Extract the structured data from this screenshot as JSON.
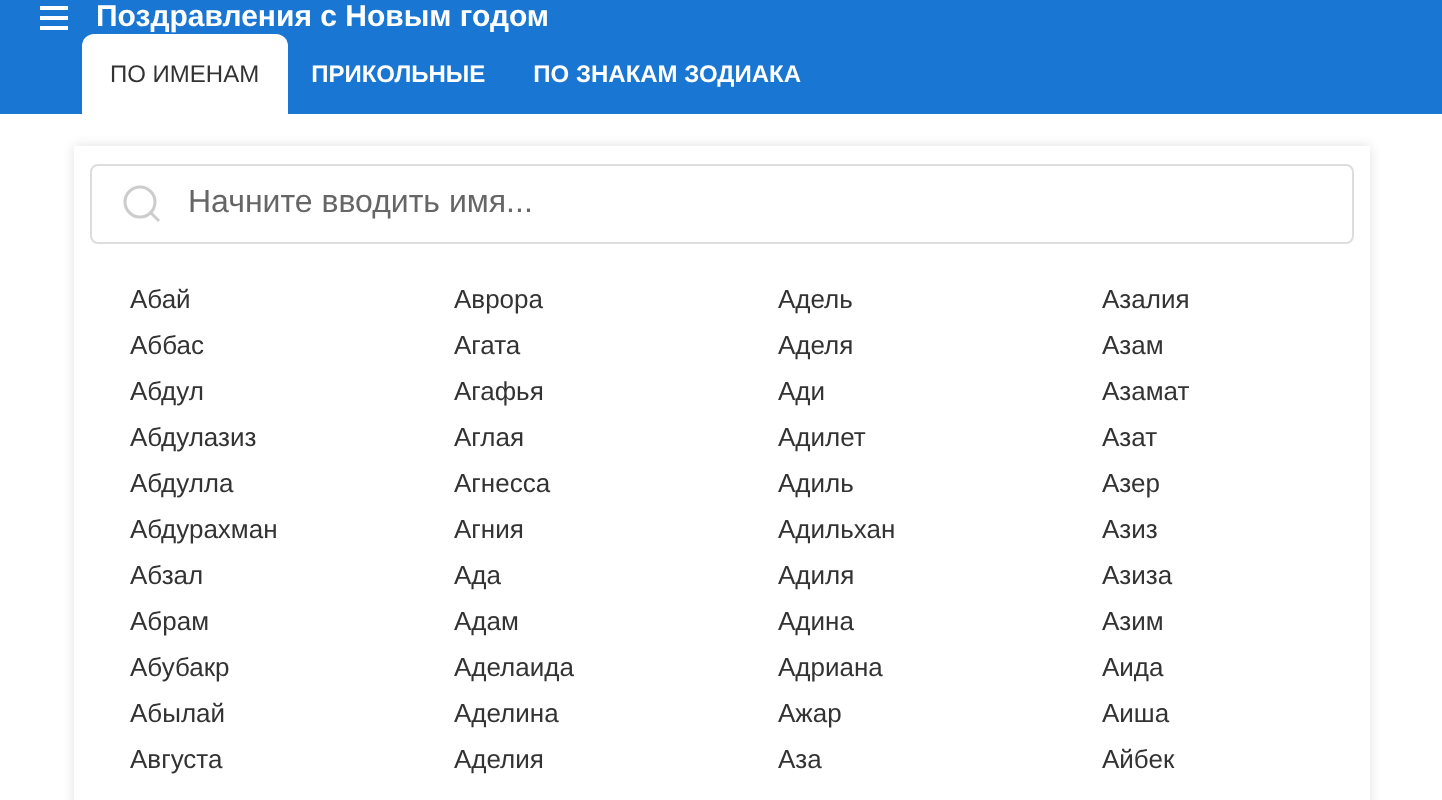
{
  "header": {
    "title": "Поздравления с Новым годом"
  },
  "tabs": [
    {
      "label": "ПО ИМЕНАМ",
      "selected": true
    },
    {
      "label": "ПРИКОЛЬНЫЕ",
      "selected": false
    },
    {
      "label": "ПО ЗНАКАМ ЗОДИАКА",
      "selected": false
    }
  ],
  "search": {
    "placeholder": "Начните вводить имя..."
  },
  "name_columns": [
    [
      "Абай",
      "Аббас",
      "Абдул",
      "Абдулазиз",
      "Абдулла",
      "Абдурахман",
      "Абзал",
      "Абрам",
      "Абубакр",
      "Абылай",
      "Августа"
    ],
    [
      "Аврора",
      "Агата",
      "Агафья",
      "Аглая",
      "Агнесса",
      "Агния",
      "Ада",
      "Адам",
      "Аделаида",
      "Аделина",
      "Аделия"
    ],
    [
      "Адель",
      "Аделя",
      "Ади",
      "Адилет",
      "Адиль",
      "Адильхан",
      "Адиля",
      "Адина",
      "Адриана",
      "Ажар",
      "Аза"
    ],
    [
      "Азалия",
      "Азам",
      "Азамат",
      "Азат",
      "Азер",
      "Азиз",
      "Азиза",
      "Азим",
      "Аида",
      "Аиша",
      "Айбек"
    ]
  ]
}
